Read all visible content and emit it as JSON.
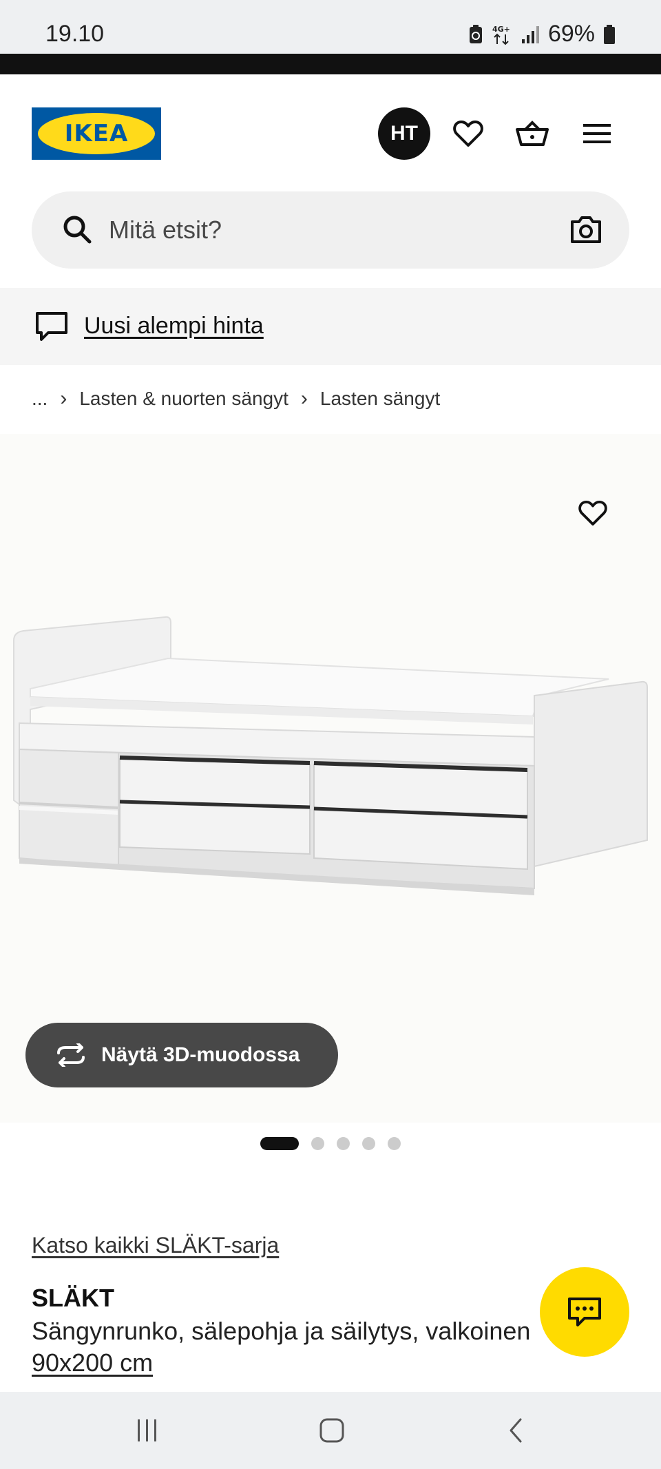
{
  "status": {
    "time": "19.10",
    "network": "4G+",
    "battery": "69%",
    "icons": [
      "battery-saver-icon",
      "data-arrows-icon",
      "signal-icon",
      "battery-icon"
    ]
  },
  "header": {
    "logo_text": "IKEA",
    "avatar_initials": "HT",
    "icons": [
      "heart-icon",
      "basket-icon",
      "menu-icon"
    ]
  },
  "search": {
    "placeholder": "Mitä etsit?",
    "value": "",
    "icons": [
      "search-icon",
      "camera-icon"
    ]
  },
  "promo": {
    "label": "Uusi alempi hinta",
    "icon": "chat-bubble-icon"
  },
  "breadcrumb": {
    "ellipsis": "...",
    "items": [
      "Lasten & nuorten sängyt",
      "Lasten sängyt"
    ]
  },
  "gallery": {
    "button_3d_label": "Näytä 3D-muodossa",
    "image_count": 5,
    "active_index": 0,
    "icons": [
      "heart-icon",
      "rotate-3d-icon"
    ]
  },
  "product": {
    "series_link": "Katso kaikki SLÄKT-sarja",
    "name": "SLÄKT",
    "description": "Sängynrunko, sälepohja ja säilytys, valkoinen",
    "size": "90x200 cm"
  },
  "fab": {
    "icon": "chat-support-icon"
  },
  "navbar": {
    "icons": [
      "recent-apps-icon",
      "home-icon",
      "back-icon"
    ]
  },
  "colors": {
    "brand_blue": "#0058a3",
    "brand_yellow": "#ffda1a",
    "fab_yellow": "#ffdb00",
    "button_dark": "#484848"
  }
}
